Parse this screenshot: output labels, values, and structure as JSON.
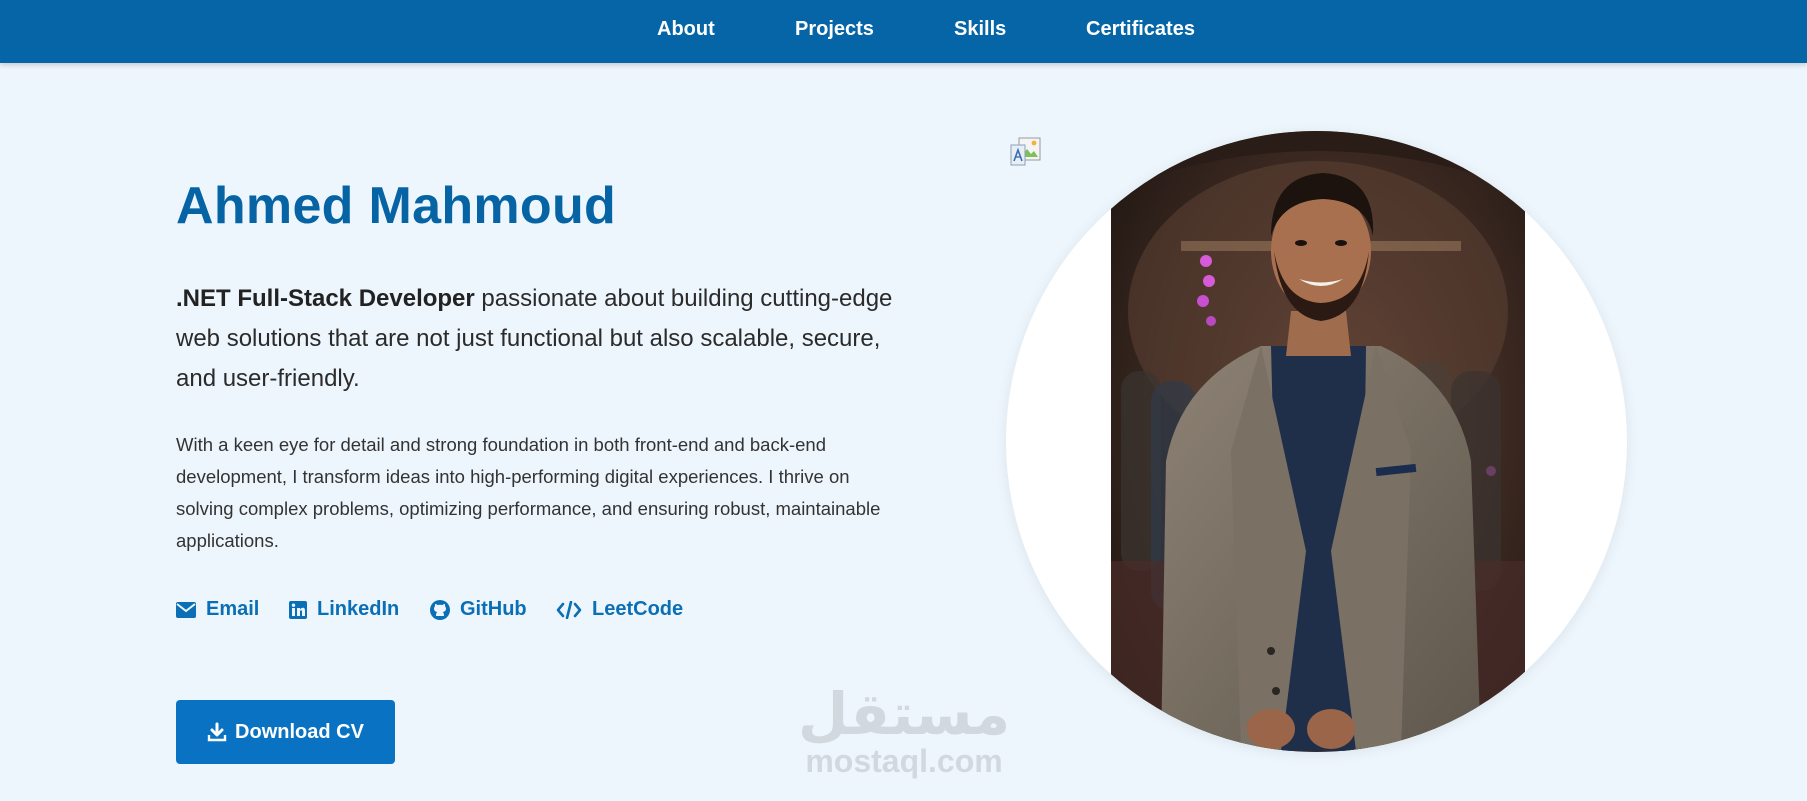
{
  "nav": {
    "items": [
      {
        "label": "About"
      },
      {
        "label": "Projects"
      },
      {
        "label": "Skills"
      },
      {
        "label": "Certificates"
      }
    ]
  },
  "hero": {
    "name": "Ahmed Mahmoud",
    "role": ".NET Full-Stack Developer",
    "tagline_rest": " passionate about building cutting-edge web solutions that are not just functional but also scalable, secure, and user-friendly.",
    "description": "With a keen eye for detail and strong foundation in both front-end and back-end development, I transform ideas into high-performing digital experiences. I thrive on solving complex problems, optimizing performance, and ensuring robust, maintainable applications."
  },
  "socials": [
    {
      "label": "Email",
      "icon": "envelope-icon"
    },
    {
      "label": "LinkedIn",
      "icon": "linkedin-icon"
    },
    {
      "label": "GitHub",
      "icon": "github-icon"
    },
    {
      "label": "LeetCode",
      "icon": "code-icon"
    }
  ],
  "download": {
    "label": "Download CV",
    "icon": "download-icon"
  },
  "watermark": {
    "arabic": "مستقل",
    "latin": "mostaql.com"
  },
  "colors": {
    "navbar": "#0565a6",
    "background": "#eef6fd",
    "accent": "#0664a4",
    "link": "#0a6fb5",
    "button": "#0a72c2"
  }
}
